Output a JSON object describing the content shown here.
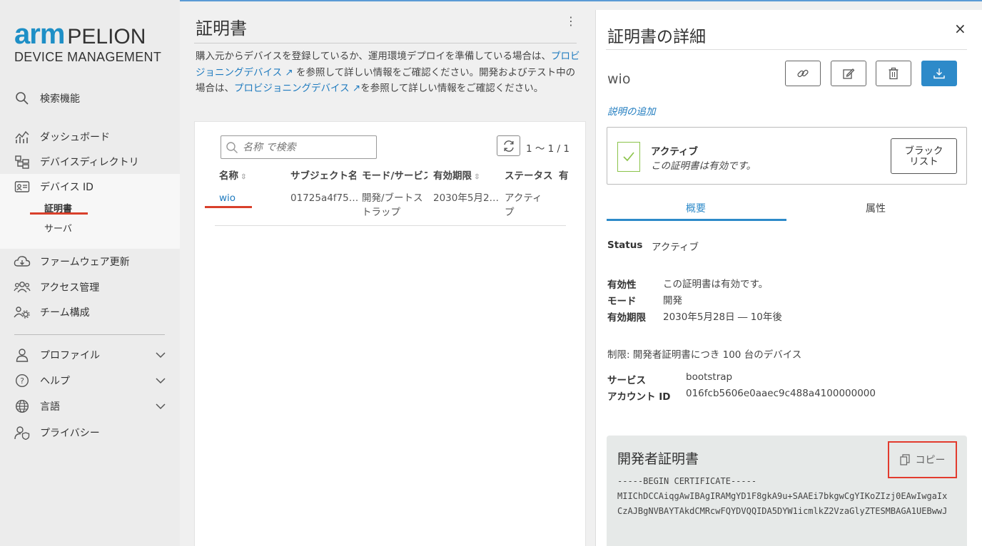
{
  "brand": {
    "arm": "arm",
    "pelion": "PELION",
    "subtitle": "DEVICE MANAGEMENT"
  },
  "sidebar": {
    "search_label": "検索機能",
    "items": [
      {
        "label": "ダッシュボード",
        "icon": "dashboard-icon"
      },
      {
        "label": "デバイスディレクトリ",
        "icon": "directory-icon"
      },
      {
        "label": "デバイス ID",
        "icon": "id-card-icon"
      },
      {
        "label": "ファームウェア更新",
        "icon": "cloud-update-icon"
      },
      {
        "label": "アクセス管理",
        "icon": "users-icon"
      },
      {
        "label": "チーム構成",
        "icon": "team-gear-icon"
      }
    ],
    "sub_items": [
      "証明書",
      "サーバ"
    ],
    "bottom": [
      {
        "label": "プロファイル",
        "icon": "person-icon"
      },
      {
        "label": "ヘルプ",
        "icon": "help-icon"
      },
      {
        "label": "言語",
        "icon": "globe-icon"
      },
      {
        "label": "プライバシー",
        "icon": "privacy-icon"
      }
    ]
  },
  "main": {
    "title": "証明書",
    "desc": {
      "p1": "購入元からデバイスを登録しているか、運用環境デプロイを準備している場合は、",
      "link1": "プロビジョニングデバイス ↗",
      "p2": " を参照して詳しい情報をご確認ください。開発およびテスト中の場合は、",
      "link2": "プロビジョニングデバイス ↗",
      "p3": "を参照して詳しい情報をご確認ください。"
    },
    "search_placeholder": "名称 で検索",
    "pager": "1 ～ 1 / 1",
    "columns": [
      "名称",
      "サブジェクト名",
      "モード/サービス",
      "有効期限",
      "ステータス",
      "有"
    ],
    "row": {
      "name": "wio",
      "subject": "01725a4f75…",
      "mode_line1": "開発/ブートス",
      "mode_line2": "トラップ",
      "expires": "2030年5月2…",
      "status_line1": "アクティ",
      "status_line2": "プ"
    }
  },
  "detail": {
    "title": "証明書の詳細",
    "close": "×",
    "name": "wio",
    "add_description": "説明の追加",
    "status_title": "アクティブ",
    "status_sub": "この証明書は有効です。",
    "blacklist_line1": "ブラック",
    "blacklist_line2": "リスト",
    "tabs": [
      "概要",
      "属性"
    ],
    "status_key": "Status",
    "status_val": "アクティブ",
    "validity_key": "有効性",
    "validity_val": "この証明書は有効です。",
    "mode_key": "モード",
    "mode_val": "開発",
    "expiry_key": "有効期限",
    "expiry_val": "2030年5月28日 ― 10年後",
    "limit": "制限: 開発者証明書につき 100 台のデバイス",
    "service_key": "サービス",
    "service_val": "bootstrap",
    "account_key": "アカウント ID",
    "account_val": "016fcb5606e0aaec9c488a4100000000",
    "cert_title": "開発者証明書",
    "copy_label": "コピー",
    "cert_lines": [
      "-----BEGIN CERTIFICATE-----",
      "MIIChDCCAiqgAwIBAgIRAMgYD1F8gkA9u+SAAEi7bkgwCgYIKoZIzj0EAwIwgaIx",
      "CzAJBgNVBAYTAkdCMRcwFQYDVQQIDA5DYW1icmlkZ2VzaGlyZTESMBAGA1UEBwwJ"
    ]
  }
}
